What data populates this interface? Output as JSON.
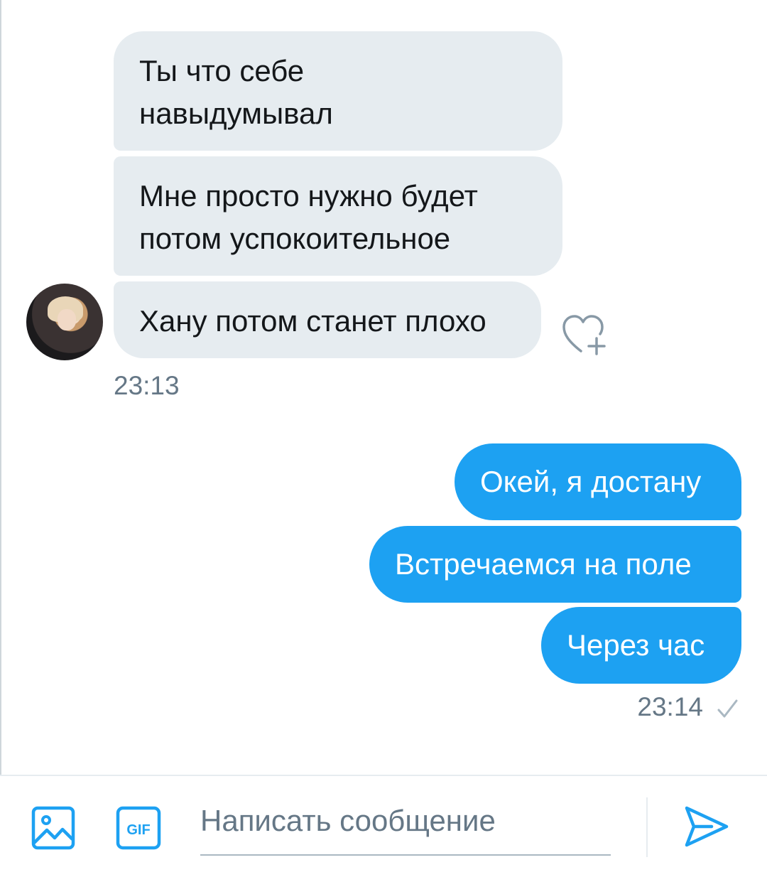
{
  "conversation": {
    "received": [
      {
        "text": "Ты что себе\nнавыдумывал"
      },
      {
        "text": "Мне просто нужно будет\nпотом успокоительное"
      },
      {
        "text": "Хану потом станет плохо"
      }
    ],
    "received_time": "23:13",
    "sent": [
      {
        "text": "Окей, я достану"
      },
      {
        "text": "Встречаемся на поле"
      },
      {
        "text": "Через час"
      }
    ],
    "sent_time": "23:14"
  },
  "icons": {
    "like": "heart-plus-icon",
    "read_status": "checkmark-icon",
    "media": "image-icon",
    "gif": "gif-icon",
    "send": "send-icon"
  },
  "compose": {
    "placeholder": "Написать сообщение",
    "gif_label": "GIF"
  },
  "colors": {
    "accent": "#1da1f2",
    "received_bubble": "#e6ecf0",
    "muted_text": "#657786"
  }
}
